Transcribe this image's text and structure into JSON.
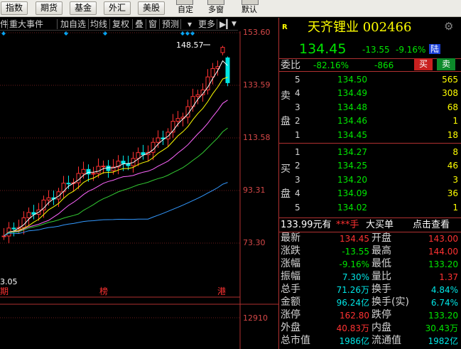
{
  "toolbar": {
    "buttons": [
      "指数",
      "期货",
      "基金",
      "外汇",
      "美股"
    ],
    "labels": [
      "自定",
      "多窗",
      "默认"
    ]
  },
  "chart_toolbar": {
    "items": [
      "事件",
      "重大事件",
      "加自选",
      "均线",
      "复权",
      "叠",
      "窗",
      "预测",
      "更多"
    ]
  },
  "chart": {
    "price_labels": [
      "153.60",
      "133.59",
      "113.58",
      "93.31",
      "73.30"
    ],
    "high_label": "148.57",
    "low_label": "3.05",
    "bottom_markers": [
      "榜",
      "港"
    ],
    "volume_label": "12910",
    "colors": {
      "up": "#ff3232",
      "down": "#00e6e6",
      "ma5": "#ffffff",
      "ma10": "#ffff00",
      "ma20": "#ff66ff",
      "ma30": "#33cc33",
      "ma60": "#3399ff"
    }
  },
  "quote": {
    "code_icon": "R",
    "title": "天齐锂业 002466",
    "price": "134.45",
    "change": "-13.55",
    "change_pct": "-9.16%",
    "market": "陆",
    "ratio_label": "委比",
    "ratio_pct": "-82.16%",
    "ratio_diff": "-866",
    "buy_btn": "买",
    "sell_btn": "卖"
  },
  "order_book": {
    "sell_chars": [
      "卖",
      "盘"
    ],
    "buy_chars": [
      "买",
      "盘"
    ],
    "sell": [
      {
        "level": "5",
        "price": "134.50",
        "vol": "565"
      },
      {
        "level": "4",
        "price": "134.49",
        "vol": "308"
      },
      {
        "level": "3",
        "price": "134.48",
        "vol": "68"
      },
      {
        "level": "2",
        "price": "134.46",
        "vol": "1"
      },
      {
        "level": "1",
        "price": "134.45",
        "vol": "18"
      }
    ],
    "buy": [
      {
        "level": "1",
        "price": "134.27",
        "vol": "8"
      },
      {
        "level": "2",
        "price": "134.25",
        "vol": "46"
      },
      {
        "level": "3",
        "price": "134.20",
        "vol": "3"
      },
      {
        "level": "4",
        "price": "134.09",
        "vol": "36"
      },
      {
        "level": "5",
        "price": "134.02",
        "vol": "1"
      }
    ]
  },
  "big_order": {
    "text1": "133.99元有",
    "stars": "***手",
    "text2": "大买单",
    "link": "点击查看"
  },
  "stats": {
    "rows": [
      {
        "l1": "最新",
        "v1": "134.45",
        "c1": "#ff3232",
        "l2": "开盘",
        "v2": "143.00",
        "c2": "#ff3232"
      },
      {
        "l1": "涨跌",
        "v1": "-13.55",
        "c1": "#00e600",
        "l2": "最高",
        "v2": "144.00",
        "c2": "#ff3232"
      },
      {
        "l1": "涨幅",
        "v1": "-9.16%",
        "c1": "#00e600",
        "l2": "最低",
        "v2": "133.20",
        "c2": "#00e600"
      },
      {
        "l1": "振幅",
        "v1": "7.30%",
        "c1": "#00e6e6",
        "l2": "量比",
        "v2": "1.37",
        "c2": "#ff3232"
      },
      {
        "l1": "总手",
        "v1": "71.26万",
        "c1": "#00e6e6",
        "l2": "换手",
        "v2": "4.84%",
        "c2": "#00e6e6"
      },
      {
        "l1": "金额",
        "v1": "96.24亿",
        "c1": "#00e6e6",
        "l2": "换手(实)",
        "v2": "6.74%",
        "c2": "#00e6e6"
      },
      {
        "l1": "涨停",
        "v1": "162.80",
        "c1": "#ff3232",
        "l2": "跌停",
        "v2": "133.20",
        "c2": "#00e600"
      },
      {
        "l1": "外盘",
        "v1": "40.83万",
        "c1": "#ff3232",
        "l2": "内盘",
        "v2": "30.43万",
        "c2": "#00e600"
      },
      {
        "l1": "总市值",
        "v1": "1986亿",
        "c1": "#00e6e6",
        "l2": "流通值",
        "v2": "1982亿",
        "c2": "#00e6e6"
      }
    ]
  }
}
